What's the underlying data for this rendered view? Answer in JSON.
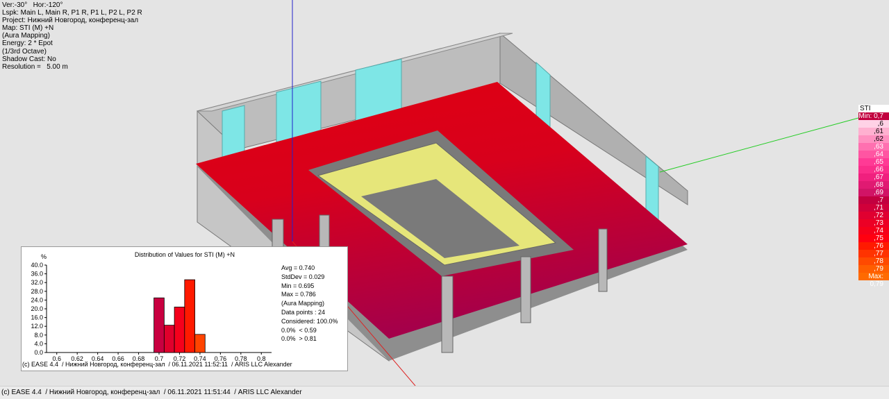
{
  "info": {
    "lines": [
      "Ver:-30°   Hor:-120°",
      "Lspk: Main L, Main R, P1 R, P1 L, P2 L, P2 R",
      "Project: Нижний Новгород, конференц-зал",
      "Map: STI (M) +N",
      "(Aura Mapping)",
      "Energy: 2 * Epot",
      "(1/3rd Octave)",
      "Shadow Cast: No",
      "Resolution =   5.00 m"
    ]
  },
  "legend": {
    "title": "STI",
    "rows": [
      {
        "label": "Min: 0,7",
        "color": "#c2003f"
      },
      {
        "label": ",6",
        "color": "#ffd2e6"
      },
      {
        "label": ",61",
        "color": "#ffb0d0"
      },
      {
        "label": ",62",
        "color": "#ff90c0"
      },
      {
        "label": ",63",
        "color": "#ff70b0"
      },
      {
        "label": ",64",
        "color": "#ff55a2"
      },
      {
        "label": ",65",
        "color": "#ff3a95"
      },
      {
        "label": ",66",
        "color": "#fa2d8a"
      },
      {
        "label": ",67",
        "color": "#f0207e"
      },
      {
        "label": ",68",
        "color": "#e01a72"
      },
      {
        "label": ",69",
        "color": "#d11466"
      },
      {
        "label": ",7",
        "color": "#c2003f"
      },
      {
        "label": ",71",
        "color": "#d0003a"
      },
      {
        "label": ",72",
        "color": "#e00030"
      },
      {
        "label": ",73",
        "color": "#ec0025"
      },
      {
        "label": ",74",
        "color": "#f5001a"
      },
      {
        "label": ",75",
        "color": "#ff0010"
      },
      {
        "label": ",76",
        "color": "#ff1a00"
      },
      {
        "label": ",77",
        "color": "#ff3300"
      },
      {
        "label": ",78",
        "color": "#ff4a00"
      },
      {
        "label": ",79",
        "color": "#ff5e00"
      },
      {
        "label": "Max: 0,79",
        "color": "#ff6a00"
      }
    ]
  },
  "histogram": {
    "title": "Distribution of Values for STI (M) +N",
    "stats": [
      "Avg = 0.740",
      "StdDev = 0.029",
      "Min = 0.695",
      "Max = 0.786",
      "(Aura Mapping)",
      "",
      "Data points : 24",
      "Considered: 100.0%",
      "0.0%  < 0.59",
      "0.0%  > 0.81"
    ],
    "footer": "(c) EASE 4.4  / Нижний Новгород, конференц-зал  / 06.11.2021 11:52:11  / ARIS LLC Alexander"
  },
  "chart_data": {
    "type": "bar",
    "title": "Distribution of Values for STI (M) +N",
    "ylabel": "%",
    "xlabel": "",
    "x_ticks": [
      "0.6",
      "0.62",
      "0.64",
      "0.66",
      "0.68",
      "0.7",
      "0.72",
      "0.74",
      "0.76",
      "0.78",
      "0.8"
    ],
    "y_ticks": [
      "0.0",
      "4.0",
      "8.0",
      "12.0",
      "16.0",
      "20.0",
      "24.0",
      "28.0",
      "32.0",
      "36.0",
      "40.0"
    ],
    "xlim": [
      0.59,
      0.81
    ],
    "ylim": [
      0,
      40
    ],
    "bars": [
      {
        "from": 0.69,
        "to": 0.7,
        "value": 25.0,
        "color": "#c80040"
      },
      {
        "from": 0.7,
        "to": 0.71,
        "value": 12.5,
        "color": "#e0002c"
      },
      {
        "from": 0.71,
        "to": 0.72,
        "value": 20.8,
        "color": "#f5001c"
      },
      {
        "from": 0.72,
        "to": 0.73,
        "value": 33.3,
        "color": "#ff1a00"
      },
      {
        "from": 0.73,
        "to": 0.74,
        "value": 8.3,
        "color": "#ff4400"
      }
    ],
    "grid": false,
    "legend": "none"
  },
  "status": {
    "text": "(c) EASE 4.4  / Нижний Новгород, конференц-зал  / 06.11.2021 11:51:44  / ARIS LLC Alexander"
  }
}
